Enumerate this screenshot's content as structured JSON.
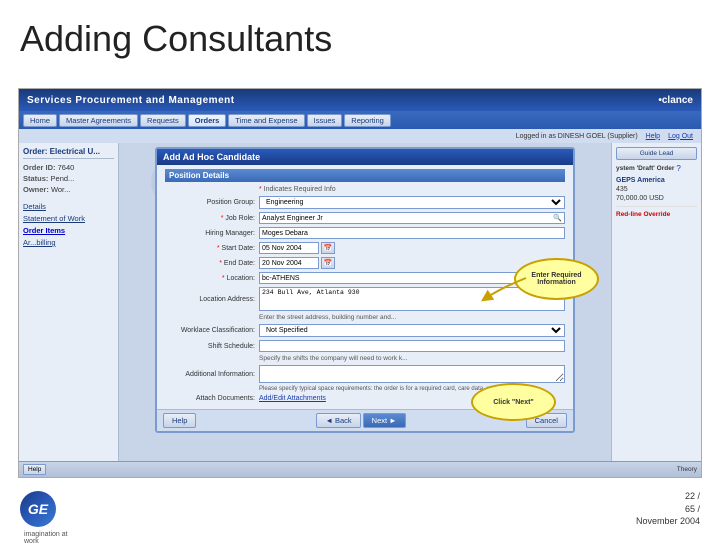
{
  "title": "Adding Consultants",
  "app": {
    "nav_title": "Services Procurement and Management",
    "brand": "•clance",
    "nav_items": [
      {
        "label": "Home",
        "active": false
      },
      {
        "label": "Master Agreements",
        "active": false
      },
      {
        "label": "Requests",
        "active": false
      },
      {
        "label": "Orders",
        "active": true
      },
      {
        "label": "Time and Expense",
        "active": false
      },
      {
        "label": "Issues",
        "active": false
      },
      {
        "label": "Reporting",
        "active": false
      }
    ],
    "logged_in": "Logged in as DINESH GOEL (Supplier)",
    "help": "Help",
    "logout": "Log Out"
  },
  "order": {
    "header": "Order: Electrical U...",
    "id_label": "Order ID:",
    "id_value": "7640",
    "status_label": "Status:",
    "status_value": "Pend...",
    "owner_label": "Owner:",
    "owner_value": "Wor..."
  },
  "sidebar_links": [
    {
      "label": "Details",
      "active": false
    },
    {
      "label": "Statement of Work",
      "active": false
    },
    {
      "label": "Order Items",
      "active": true
    },
    {
      "label": "Ar...billing",
      "active": false
    }
  ],
  "modal": {
    "title": "Add Ad Hoc Candidate",
    "section_title": "Position Details",
    "fields": [
      {
        "label": "* Indicates Required Info",
        "value": "",
        "type": "header"
      },
      {
        "label": "Position Group:",
        "value": "Engineering",
        "type": "select"
      },
      {
        "label": "* Job Role:",
        "value": "Analyst Engineer Jr",
        "type": "input_search"
      },
      {
        "label": "Hiring Manager:",
        "value": "Moges Debara",
        "type": "text"
      },
      {
        "label": "Start Date:",
        "value": "05 Nov 2004",
        "type": "date"
      },
      {
        "label": "End Date:",
        "value": "20 Nov 2004",
        "type": "date"
      },
      {
        "label": "* Location:",
        "value": "bc-ATHENS",
        "type": "input_search"
      },
      {
        "label": "Location Address:",
        "value": "234 Bull Ave, Atlanta 930",
        "type": "textarea"
      },
      {
        "label": "",
        "value": "Enter the street address, building number and...",
        "type": "hint"
      },
      {
        "label": "Worklace Classification:",
        "value": "Not Specified",
        "type": "select"
      },
      {
        "label": "Shift Schedule:",
        "value": "",
        "type": "input",
        "hint": "Specify the shifts the company will need to work k..."
      },
      {
        "label": "Additional Information:",
        "value": "",
        "type": "textarea2"
      },
      {
        "label": "",
        "value": "Please specify typical space requirements: the order is for a required card, care data, etc.",
        "type": "hint2"
      },
      {
        "label": "Attach Documents:",
        "value": "Add/Edit Attachments",
        "type": "link"
      }
    ],
    "footer": {
      "help_btn": "Help",
      "back_btn": "Back",
      "next_btn": "Next",
      "cancel_btn": "Cancel"
    }
  },
  "right_sidebar": {
    "guide_btn": "Guide Lead",
    "section_title": "ystem 'Draft' Order",
    "supplier": "GEPS America",
    "supplier_id": "435",
    "amount": "70,000.00 USD",
    "override_label": "Red-line Override"
  },
  "callouts": {
    "enter_info": "Enter Required Information",
    "click_next": "Click \"Next\""
  },
  "ge_footer": {
    "logo_text": "GE",
    "tagline": "imagination at work",
    "page_num": "22 /",
    "course_num": "65 /",
    "date": "November 2004"
  }
}
